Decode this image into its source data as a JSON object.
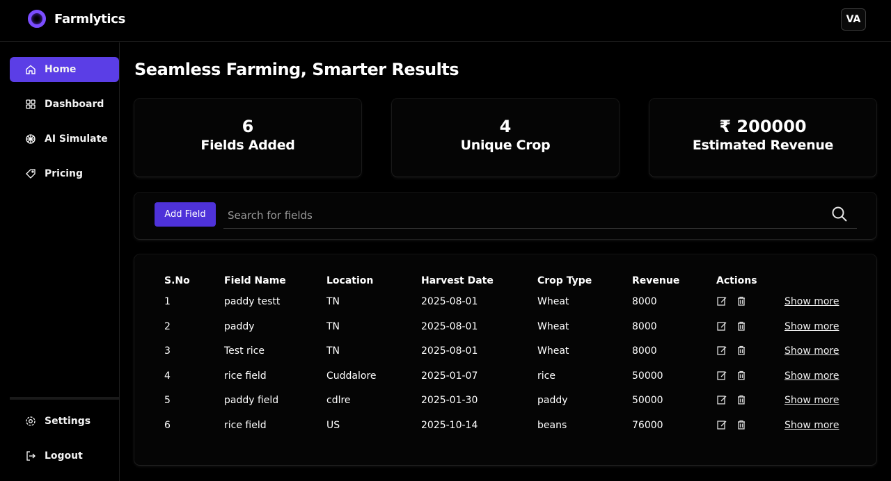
{
  "app": {
    "brand": "Farmlytics",
    "avatar_initials": "VA"
  },
  "sidebar": {
    "items": [
      {
        "label": "Home",
        "icon": "home-icon",
        "active": true
      },
      {
        "label": "Dashboard",
        "icon": "dashboard-icon",
        "active": false
      },
      {
        "label": "AI Simulate",
        "icon": "ai-icon",
        "active": false
      },
      {
        "label": "Pricing",
        "icon": "tag-icon",
        "active": false
      }
    ],
    "bottom_items": [
      {
        "label": "Settings",
        "icon": "gear-icon"
      },
      {
        "label": "Logout",
        "icon": "logout-icon"
      }
    ]
  },
  "main": {
    "heading": "Seamless Farming, Smarter Results",
    "stats": [
      {
        "value": "6",
        "label": "Fields Added"
      },
      {
        "value": "4",
        "label": "Unique Crop"
      },
      {
        "value": "₹ 200000",
        "label": "Estimated Revenue"
      }
    ],
    "add_button_label": "Add Field",
    "search_placeholder": "Search for fields",
    "table": {
      "headers": [
        "S.No",
        "Field Name",
        "Location",
        "Harvest Date",
        "Crop Type",
        "Revenue",
        "Actions"
      ],
      "show_more_label": "Show more",
      "rows": [
        [
          "1",
          "paddy testt",
          "TN",
          "2025-08-01",
          "Wheat",
          "8000"
        ],
        [
          "2",
          "paddy",
          "TN",
          "2025-08-01",
          "Wheat",
          "8000"
        ],
        [
          "3",
          "Test rice",
          "TN",
          "2025-08-01",
          "Wheat",
          "8000"
        ],
        [
          "4",
          "rice field",
          "Cuddalore",
          "2025-01-07",
          "rice",
          "50000"
        ],
        [
          "5",
          "paddy field",
          "cdlre",
          "2025-01-30",
          "paddy",
          "50000"
        ],
        [
          "6",
          "rice field",
          "US",
          "2025-10-14",
          "beans",
          "76000"
        ]
      ]
    }
  },
  "colors": {
    "accent": "#5b3ee6",
    "button": "#4e32d9",
    "logo_ring": "#7b4dff",
    "background": "#000000"
  }
}
